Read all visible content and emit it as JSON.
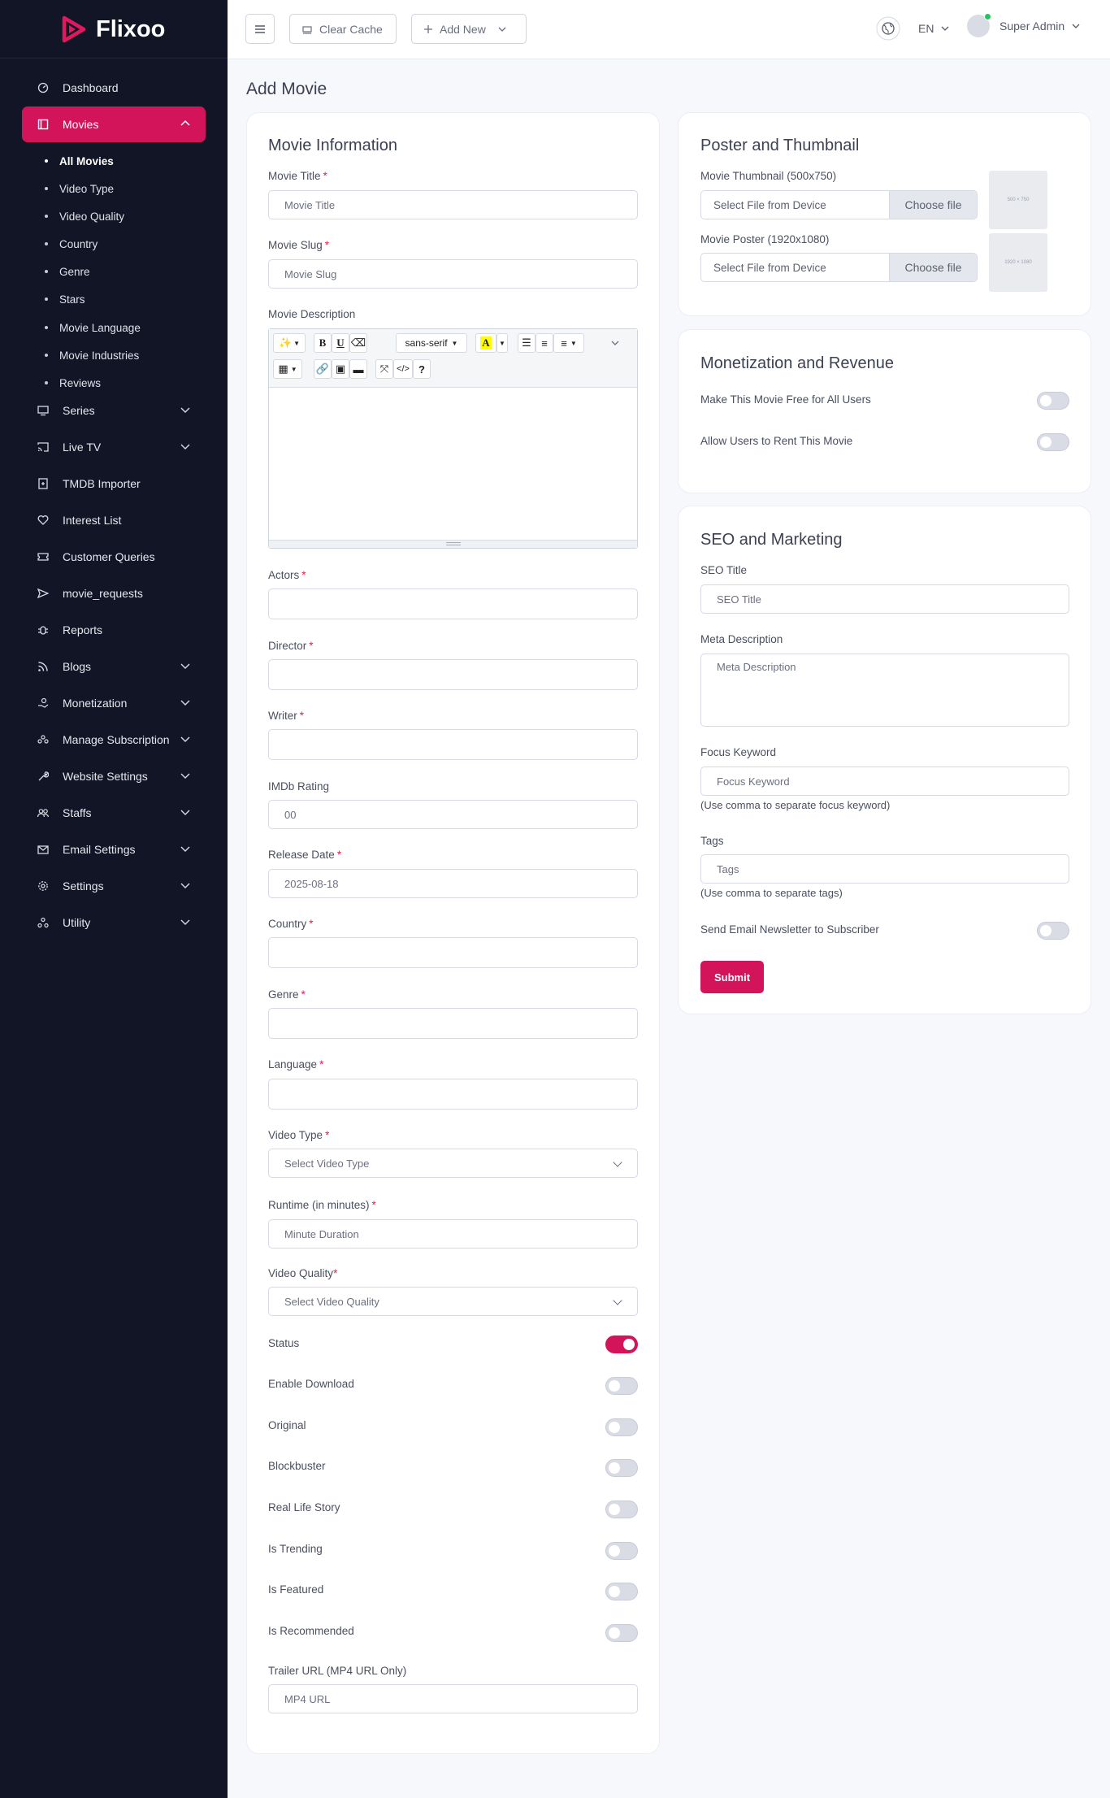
{
  "brand": {
    "name": "Flixoo"
  },
  "sidebar": {
    "items": [
      {
        "label": "Dashboard"
      },
      {
        "label": "Movies"
      },
      {
        "label": "Series"
      },
      {
        "label": "Live TV"
      },
      {
        "label": "TMDB Importer"
      },
      {
        "label": "Interest List"
      },
      {
        "label": "Customer Queries"
      },
      {
        "label": "movie_requests"
      },
      {
        "label": "Reports"
      },
      {
        "label": "Blogs"
      },
      {
        "label": "Monetization"
      },
      {
        "label": "Manage Subscription"
      },
      {
        "label": "Website Settings"
      },
      {
        "label": "Staffs"
      },
      {
        "label": "Email Settings"
      },
      {
        "label": "Settings"
      },
      {
        "label": "Utility"
      }
    ],
    "movies_sub": [
      "All Movies",
      "Video Type",
      "Video Quality",
      "Country",
      "Genre",
      "Stars",
      "Movie Language",
      "Movie Industries",
      "Reviews"
    ]
  },
  "topbar": {
    "clear_cache": "Clear Cache",
    "add_new": "Add New",
    "lang": "EN",
    "user": "Super Admin"
  },
  "page": {
    "title": "Add Movie"
  },
  "movie_info": {
    "title": "Movie Information",
    "movie_title": {
      "label": "Movie Title",
      "placeholder": "Movie Title"
    },
    "movie_slug": {
      "label": "Movie Slug",
      "placeholder": "Movie Slug"
    },
    "description": {
      "label": "Movie Description",
      "font": "sans-serif"
    },
    "actors": {
      "label": "Actors"
    },
    "director": {
      "label": "Director"
    },
    "writer": {
      "label": "Writer"
    },
    "imdb": {
      "label": "IMDb Rating",
      "value": "00"
    },
    "release": {
      "label": "Release Date",
      "value": "2025-08-18"
    },
    "country": {
      "label": "Country"
    },
    "genre": {
      "label": "Genre"
    },
    "language": {
      "label": "Language"
    },
    "video_type": {
      "label": "Video Type",
      "value": "Select Video Type"
    },
    "runtime": {
      "label": "Runtime (in minutes)",
      "placeholder": "Minute Duration"
    },
    "video_quality": {
      "label": "Video Quality",
      "value": "Select Video Quality"
    },
    "toggles": [
      {
        "label": "Status",
        "on": true
      },
      {
        "label": "Enable Download",
        "on": false
      },
      {
        "label": "Original",
        "on": false
      },
      {
        "label": "Blockbuster",
        "on": false
      },
      {
        "label": "Real Life Story",
        "on": false
      },
      {
        "label": "Is Trending",
        "on": false
      },
      {
        "label": "Is Featured",
        "on": false
      },
      {
        "label": "Is Recommended",
        "on": false
      }
    ],
    "trailer": {
      "label": "Trailer URL (MP4 URL Only)",
      "placeholder": "MP4 URL"
    }
  },
  "poster": {
    "title": "Poster and Thumbnail",
    "thumb_label": "Movie Thumbnail (500x750)",
    "poster_label": "Movie Poster (1920x1080)",
    "file_text": "Select File from Device",
    "choose": "Choose file",
    "thumb_size": "500 × 750",
    "poster_size": "1920 × 1080"
  },
  "monetization": {
    "title": "Monetization and Revenue",
    "free_label": "Make This Movie Free for All Users",
    "rent_label": "Allow Users to Rent This Movie"
  },
  "seo": {
    "title": "SEO and Marketing",
    "seo_title": {
      "label": "SEO Title",
      "placeholder": "SEO Title"
    },
    "meta": {
      "label": "Meta Description",
      "placeholder": "Meta Description"
    },
    "focus": {
      "label": "Focus Keyword",
      "placeholder": "Focus Keyword",
      "help": "(Use comma to separate focus keyword)"
    },
    "tags": {
      "label": "Tags",
      "placeholder": "Tags",
      "help": "(Use comma to separate tags)"
    },
    "newsletter": "Send Email Newsletter to Subscriber",
    "submit": "Submit"
  },
  "colors": {
    "accent": "#d3135a",
    "sidebar": "#121525"
  }
}
